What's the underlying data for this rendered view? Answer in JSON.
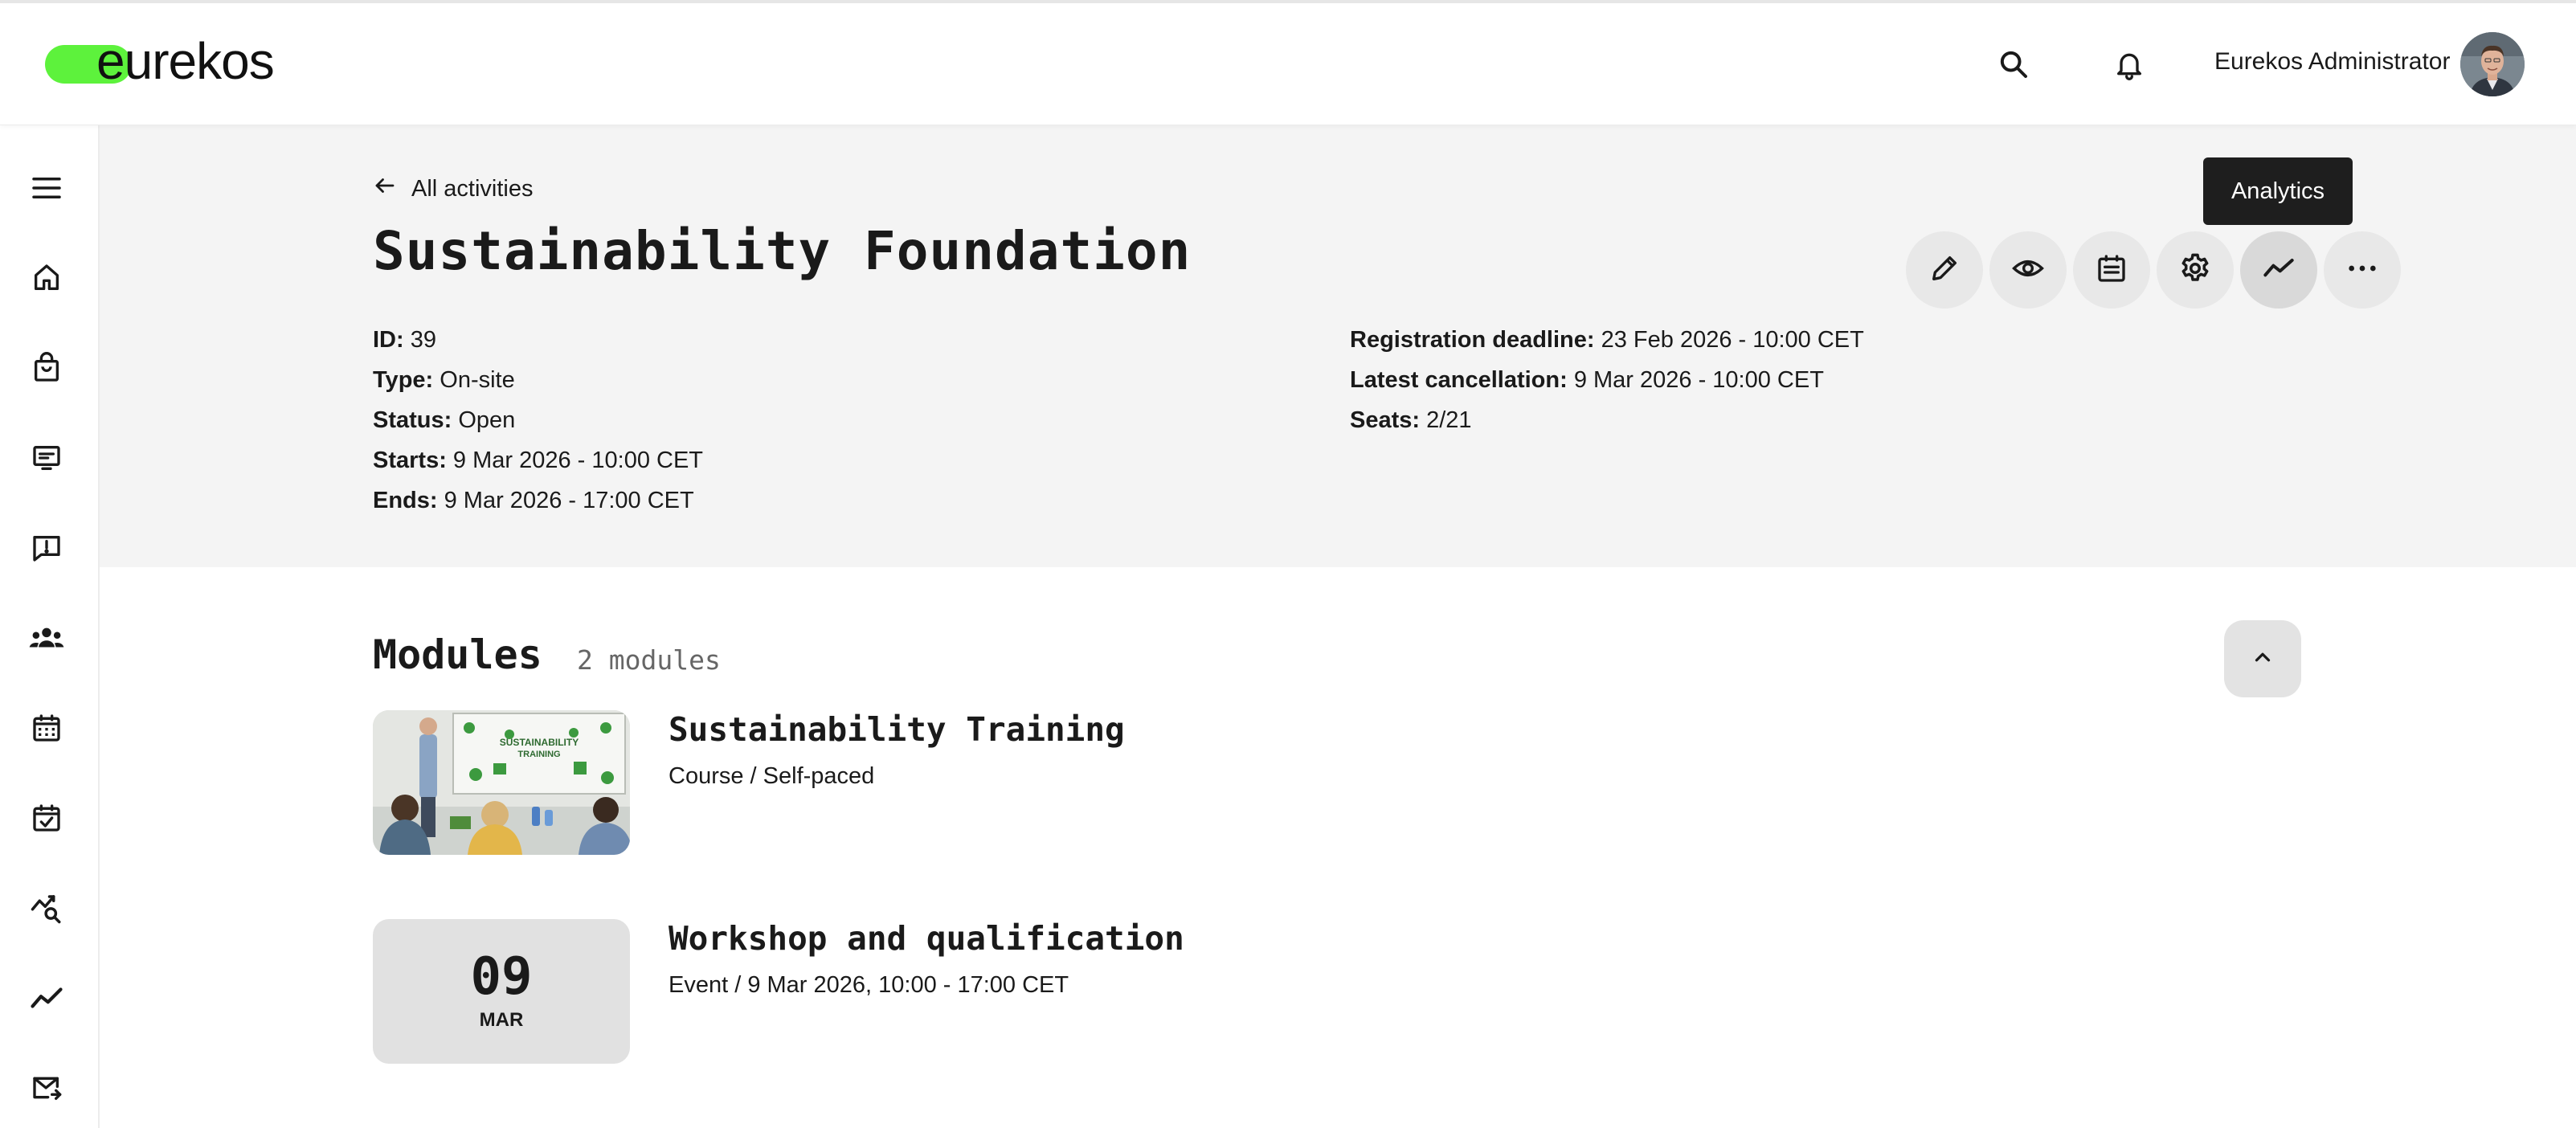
{
  "brand": {
    "name": "eurekos",
    "accent": "#5df23c"
  },
  "topbar": {
    "user_name": "Eurekos Administrator",
    "icons": [
      "search-icon",
      "bell-icon"
    ]
  },
  "sidebar": {
    "items": [
      "menu-icon",
      "home-icon",
      "bag-icon",
      "presentation-icon",
      "feedback-icon",
      "group-icon",
      "calendar-icon",
      "calendar-check-icon",
      "analytics-search-icon",
      "trend-icon",
      "mail-icon"
    ]
  },
  "header": {
    "back_label": "All activities",
    "title": "Sustainability Foundation",
    "left_meta": [
      {
        "label": "ID:",
        "value": "39"
      },
      {
        "label": "Type:",
        "value": "On-site"
      },
      {
        "label": "Status:",
        "value": "Open"
      },
      {
        "label": "Starts:",
        "value": "9 Mar 2026 - 10:00 CET"
      },
      {
        "label": "Ends:",
        "value": "9 Mar 2026 - 17:00 CET"
      }
    ],
    "right_meta": [
      {
        "label": "Registration deadline:",
        "value": "23 Feb 2026 - 10:00 CET"
      },
      {
        "label": "Latest cancellation:",
        "value": "9 Mar 2026 - 10:00 CET"
      },
      {
        "label": "Seats:",
        "value": "2/21"
      }
    ],
    "actions": [
      "edit",
      "preview",
      "schedule",
      "settings",
      "analytics",
      "more"
    ],
    "tooltip": "Analytics"
  },
  "modules": {
    "title": "Modules",
    "count": "2 modules",
    "items": [
      {
        "title": "Sustainability Training",
        "subtitle": "Course / Self-paced",
        "thumb_board_text": "SUSTAINABILITY TRAINING"
      },
      {
        "title": "Workshop and qualification",
        "subtitle": "Event / 9 Mar 2026, 10:00 - 17:00 CET",
        "date_day": "09",
        "date_month": "MAR"
      }
    ]
  }
}
